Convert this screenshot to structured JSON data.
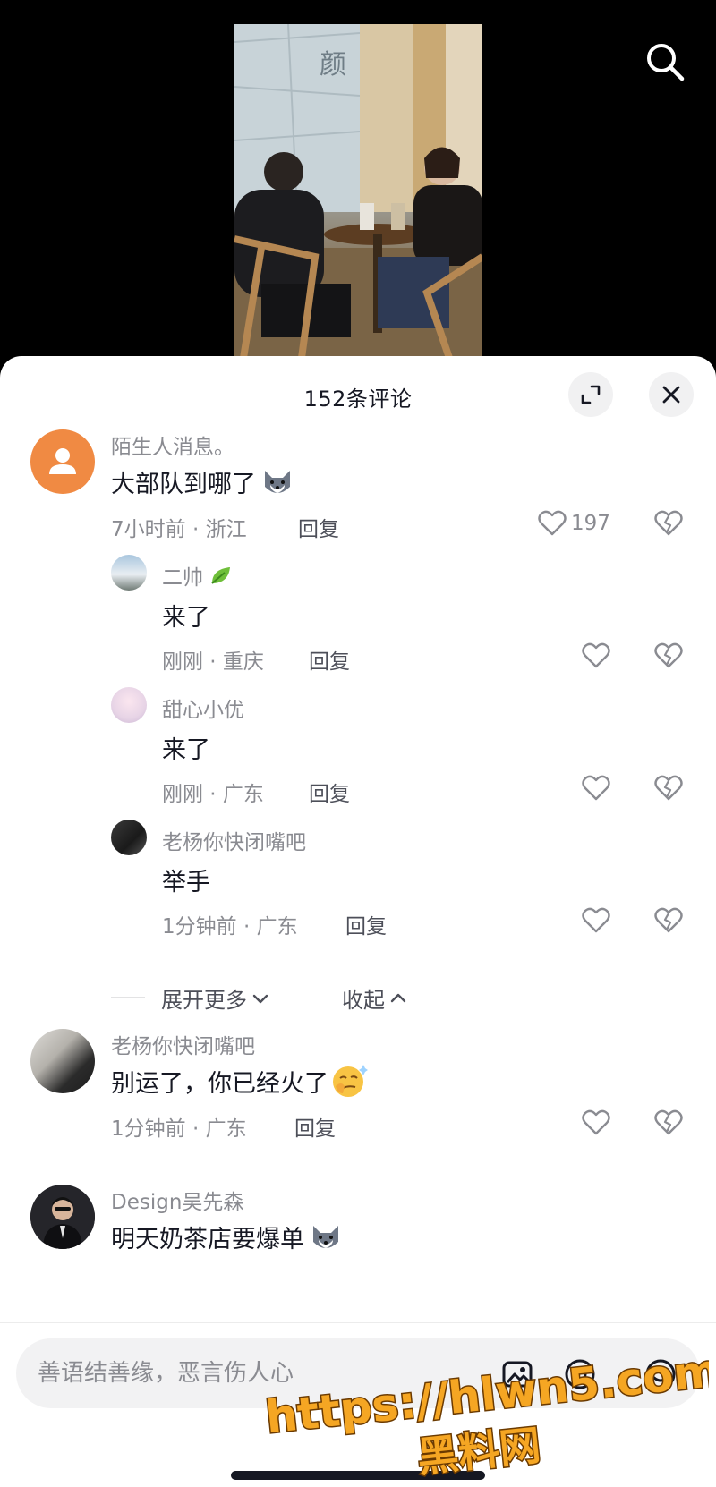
{
  "header": {
    "title": "152条评论"
  },
  "comments": [
    {
      "username": "陌生人消息。",
      "text": "大部队到哪了",
      "time_location": "7小时前 · 浙江",
      "reply_label": "回复",
      "likes": "197",
      "emoji": "husky-emoji"
    },
    {
      "username": "二帅",
      "text": "来了",
      "time_location": "刚刚 · 重庆",
      "reply_label": "回复"
    },
    {
      "username": "甜心小优",
      "text": "来了",
      "time_location": "刚刚 · 广东",
      "reply_label": "回复"
    },
    {
      "username": "老杨你快闭嘴吧",
      "text": "举手",
      "time_location": "1分钟前 · 广东",
      "reply_label": "回复"
    },
    {
      "username": "老杨你快闭嘴吧",
      "text": "别运了，你已经火了",
      "time_location": "1分钟前 · 广东",
      "reply_label": "回复",
      "emoji": "smirk-emoji"
    },
    {
      "username": "Design吴先森",
      "text": "明天奶茶店要爆单",
      "emoji": "husky-emoji"
    }
  ],
  "thread": {
    "expand_more": "展开更多",
    "collapse": "收起"
  },
  "input": {
    "placeholder": "善语结善缘，恶言伤人心"
  },
  "watermark": {
    "line1": "https://hlwn5.com",
    "line2": "黑料网"
  },
  "colors": {
    "accent_avatar": "#f08a43",
    "watermark": "#f5a623",
    "text_primary": "#161823",
    "text_secondary": "#8a8b91"
  }
}
